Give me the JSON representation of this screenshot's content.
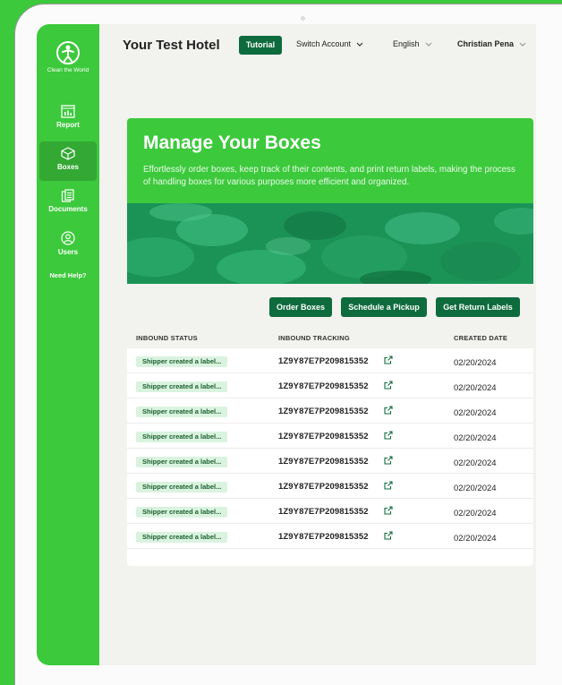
{
  "brand": {
    "logo_text": "Clean the World",
    "accent": "#3cc93c",
    "dark_green": "#0e6b3d"
  },
  "sidebar": {
    "items": [
      {
        "label": "Report",
        "icon": "chart-icon"
      },
      {
        "label": "Boxes",
        "icon": "box-icon",
        "active": true
      },
      {
        "label": "Documents",
        "icon": "documents-icon"
      },
      {
        "label": "Users",
        "icon": "user-icon"
      }
    ],
    "help": "Need Help?"
  },
  "header": {
    "hotel": "Your Test Hotel",
    "tutorial": "Tutorial",
    "switch_account": "Switch Account",
    "language": "English",
    "user": "Christian Pena"
  },
  "hero": {
    "title": "Manage Your Boxes",
    "subtitle": "Effortlessly order boxes, keep track of their contents, and print return labels, making the process of handling boxes for various purposes more efficient and organized."
  },
  "actions": {
    "order": "Order Boxes",
    "pickup": "Schedule a Pickup",
    "labels": "Get Return Labels"
  },
  "table": {
    "headers": {
      "status": "INBOUND STATUS",
      "tracking": "INBOUND TRACKING",
      "date": "CREATED DATE"
    },
    "rows": [
      {
        "status": "Shipper created a label...",
        "tracking": "1Z9Y87E7P209815352",
        "date": "02/20/2024"
      },
      {
        "status": "Shipper created a label...",
        "tracking": "1Z9Y87E7P209815352",
        "date": "02/20/2024"
      },
      {
        "status": "Shipper created a label...",
        "tracking": "1Z9Y87E7P209815352",
        "date": "02/20/2024"
      },
      {
        "status": "Shipper created a label...",
        "tracking": "1Z9Y87E7P209815352",
        "date": "02/20/2024"
      },
      {
        "status": "Shipper created a label...",
        "tracking": "1Z9Y87E7P209815352",
        "date": "02/20/2024"
      },
      {
        "status": "Shipper created a label...",
        "tracking": "1Z9Y87E7P209815352",
        "date": "02/20/2024"
      },
      {
        "status": "Shipper created a label...",
        "tracking": "1Z9Y87E7P209815352",
        "date": "02/20/2024"
      },
      {
        "status": "Shipper created a label...",
        "tracking": "1Z9Y87E7P209815352",
        "date": "02/20/2024"
      }
    ]
  }
}
